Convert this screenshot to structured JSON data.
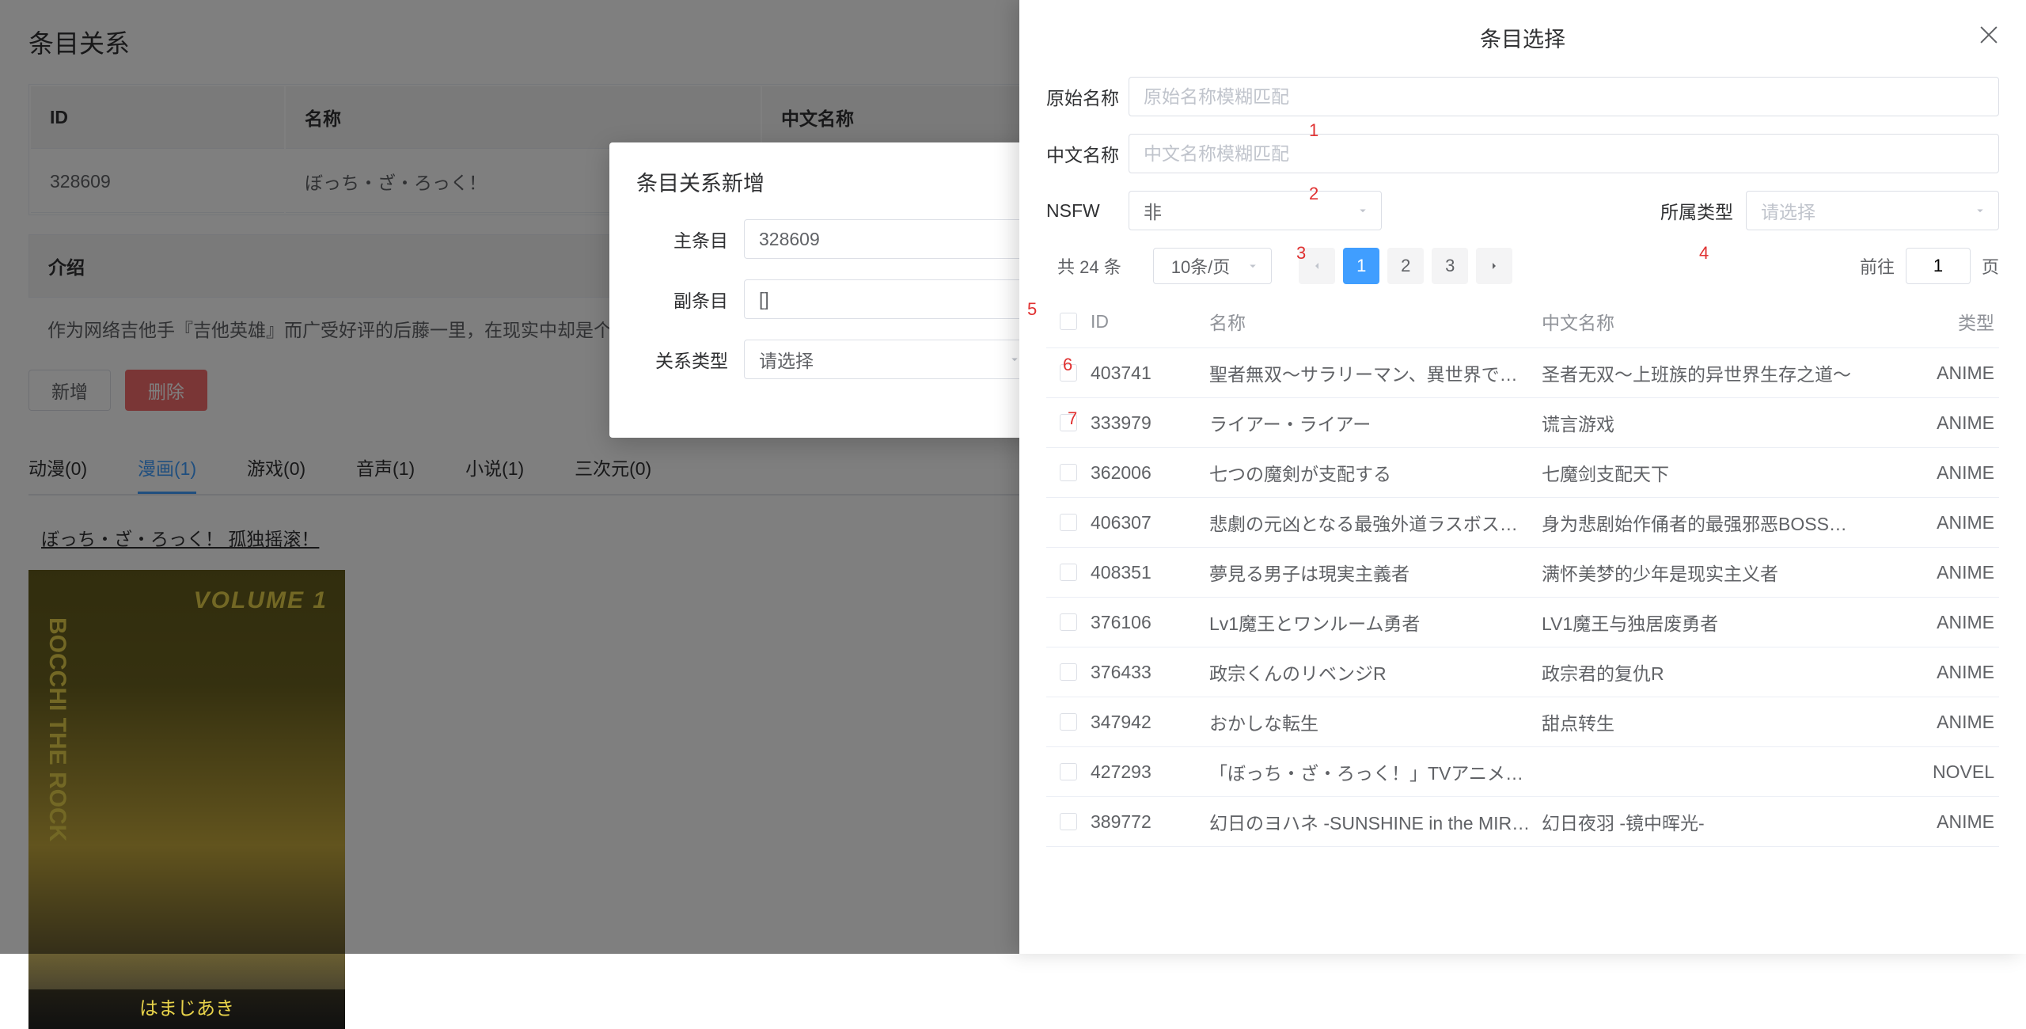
{
  "bg": {
    "title": "条目关系",
    "table": {
      "h_id": "ID",
      "h_name": "名称",
      "h_cn": "中文名称",
      "id": "328609",
      "name": "ぼっち・ざ・ろっく！",
      "intro_label": "介绍",
      "intro": "作为网络吉他手『吉他英雄』而广受好评的后藤一里，在现实中却是个什么都不会… …合作经历的一里，在人前完全发挥不出原本的实力。为了努力克服沟通障碍，…"
    },
    "btn_new": "新增",
    "btn_del": "删除",
    "tabs": {
      "anime": "动漫(0)",
      "manga": "漫画(1)",
      "game": "游戏(0)",
      "audio": "音声(1)",
      "novel": "小说(1)",
      "real": "三次元(0)"
    },
    "link": "ぼっち・ざ・ろっく！ 孤独摇滚！",
    "cover": {
      "volume": "VOLUME 1",
      "side": "BOCCHI THE ROCK",
      "band": "はまじあき"
    }
  },
  "modal": {
    "title": "条目关系新增",
    "l_main": "主条目",
    "l_sub": "副条目",
    "l_rel": "关系类型",
    "v_main": "328609",
    "v_sub": "[]",
    "v_rel": "请选择"
  },
  "drawer": {
    "title": "条目选择",
    "f_orig_label": "原始名称",
    "f_orig_ph": "原始名称模糊匹配",
    "f_cn_label": "中文名称",
    "f_cn_ph": "中文名称模糊匹配",
    "f_nsfw_label": "NSFW",
    "f_nsfw_val": "非",
    "f_type_label": "所属类型",
    "f_type_ph": "请选择",
    "total_text": "共 24 条",
    "page_size": "10条/页",
    "goto_pre": "前往",
    "goto_val": "1",
    "goto_post": "页",
    "cols": {
      "id": "ID",
      "name": "名称",
      "cn": "中文名称",
      "type": "类型"
    },
    "rows": [
      {
        "id": "403741",
        "name": "聖者無双～サラリーマン、異世界で生…",
        "cn": "圣者无双～上班族的异世界生存之道～",
        "type": "ANIME"
      },
      {
        "id": "333979",
        "name": "ライアー・ライアー",
        "cn": "谎言游戏",
        "type": "ANIME"
      },
      {
        "id": "362006",
        "name": "七つの魔剣が支配する",
        "cn": "七魔剑支配天下",
        "type": "ANIME"
      },
      {
        "id": "406307",
        "name": "悲劇の元凶となる最強外道ラスボス女…",
        "cn": "身为悲剧始作俑者的最强邪恶BOSS女…",
        "type": "ANIME"
      },
      {
        "id": "408351",
        "name": "夢見る男子は現実主義者",
        "cn": "满怀美梦的少年是现实主义者",
        "type": "ANIME"
      },
      {
        "id": "376106",
        "name": "Lv1魔王とワンルーム勇者",
        "cn": "LV1魔王与独居废勇者",
        "type": "ANIME"
      },
      {
        "id": "376433",
        "name": "政宗くんのリベンジR",
        "cn": "政宗君的复仇R",
        "type": "ANIME"
      },
      {
        "id": "347942",
        "name": "おかしな転生",
        "cn": "甜点转生",
        "type": "ANIME"
      },
      {
        "id": "427293",
        "name": "「ぼっち・ざ・ろっく！」TVアニメ公…",
        "cn": "",
        "type": "NOVEL"
      },
      {
        "id": "389772",
        "name": "幻日のヨハネ -SUNSHINE in the MIR…",
        "cn": "幻日夜羽 -镜中晖光-",
        "type": "ANIME"
      }
    ]
  },
  "annotations": [
    "1",
    "2",
    "3",
    "4",
    "5",
    "6",
    "7"
  ]
}
